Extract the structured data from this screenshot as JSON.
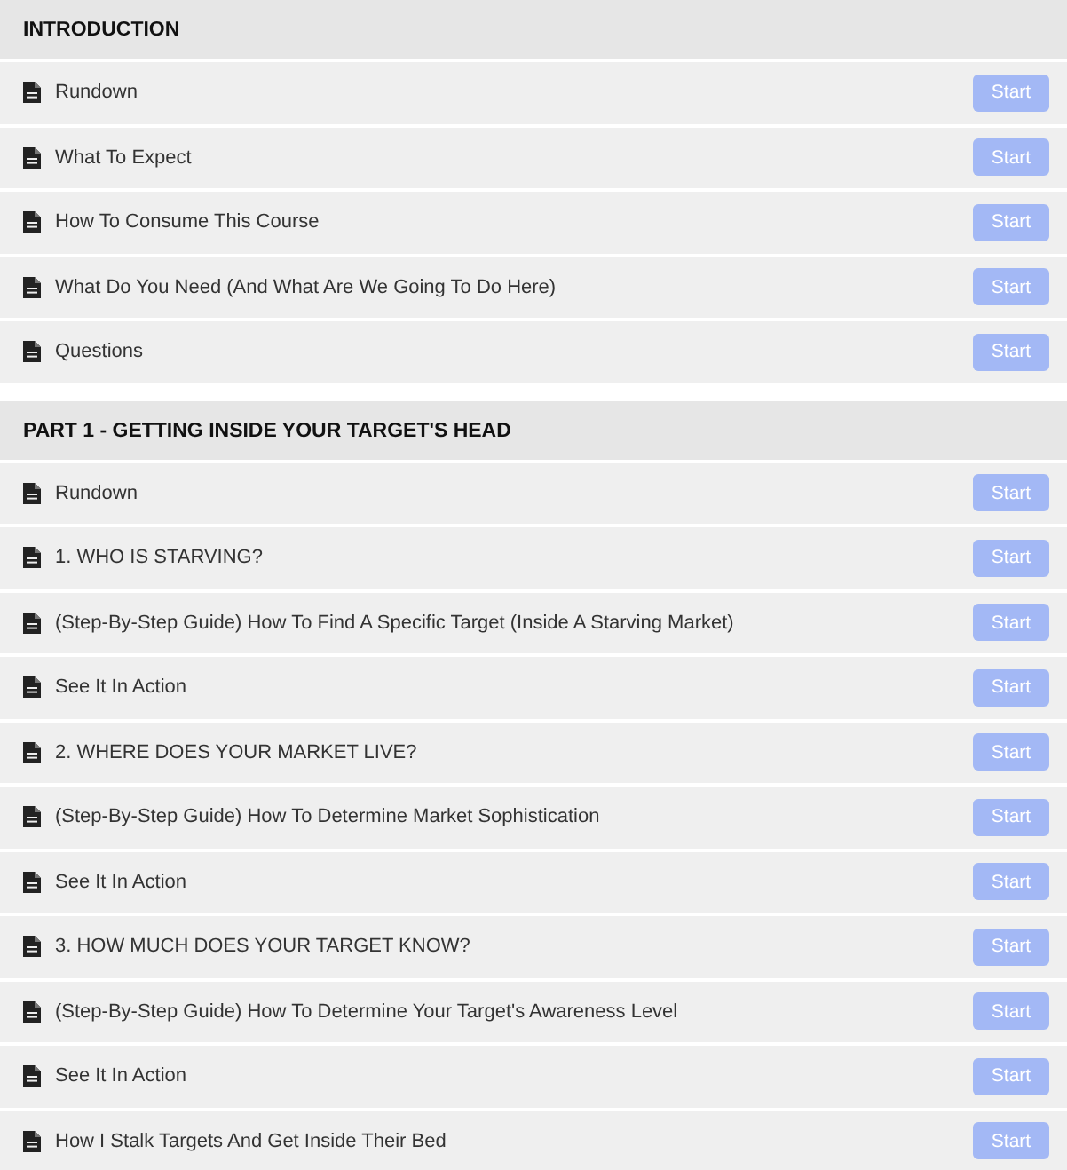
{
  "sections": [
    {
      "title": "INTRODUCTION",
      "lectures": [
        {
          "title": "Rundown",
          "button": "Start"
        },
        {
          "title": "What To Expect",
          "button": "Start"
        },
        {
          "title": "How To Consume This Course",
          "button": "Start"
        },
        {
          "title": "What Do You Need (And What Are We Going To Do Here)",
          "button": "Start"
        },
        {
          "title": "Questions",
          "button": "Start"
        }
      ]
    },
    {
      "title": "PART 1 - GETTING INSIDE YOUR TARGET'S HEAD",
      "lectures": [
        {
          "title": "Rundown",
          "button": "Start"
        },
        {
          "title": "1. WHO IS STARVING?",
          "button": "Start"
        },
        {
          "title": "(Step-By-Step Guide) How To Find A Specific Target (Inside A Starving Market)",
          "button": "Start"
        },
        {
          "title": "See It In Action",
          "button": "Start"
        },
        {
          "title": "2. WHERE DOES YOUR MARKET LIVE?",
          "button": "Start"
        },
        {
          "title": "(Step-By-Step Guide) How To Determine Market Sophistication",
          "button": "Start"
        },
        {
          "title": "See It In Action",
          "button": "Start"
        },
        {
          "title": "3. HOW MUCH DOES YOUR TARGET KNOW?",
          "button": "Start"
        },
        {
          "title": "(Step-By-Step Guide) How To Determine Your Target's Awareness Level",
          "button": "Start"
        },
        {
          "title": "See It In Action",
          "button": "Start"
        },
        {
          "title": "How I Stalk Targets And Get Inside Their Bed",
          "button": "Start"
        }
      ]
    }
  ]
}
